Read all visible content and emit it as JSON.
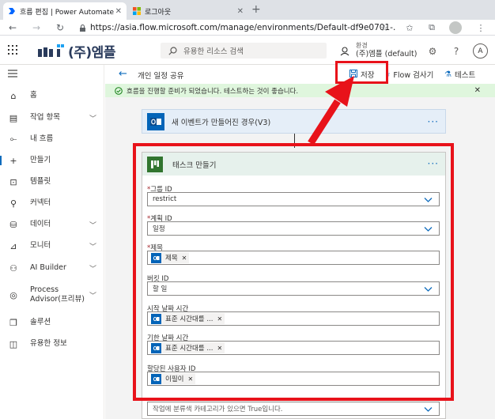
{
  "browser": {
    "tabs": [
      {
        "title": "흐름 편집 | Power Automate",
        "active": true
      },
      {
        "title": "로그아웃",
        "active": false
      }
    ],
    "url": "https://asia.flow.microsoft.com/manage/environments/Default-df9e0701-..."
  },
  "header": {
    "brand": "(주)엠플",
    "search_placeholder": "유용한 리소스 검색",
    "env_label": "환경",
    "env_value": "(주)엠플 (default)",
    "avatar_initial": "A"
  },
  "sidebar": {
    "items": [
      {
        "label": "홈",
        "icon": "home-icon",
        "has_chevron": false
      },
      {
        "label": "작업 항목",
        "icon": "clipboard-icon",
        "has_chevron": true
      },
      {
        "label": "내 흐름",
        "icon": "flow-icon",
        "has_chevron": false
      },
      {
        "label": "만들기",
        "icon": "plus-icon",
        "has_chevron": false,
        "active": true
      },
      {
        "label": "템플릿",
        "icon": "template-icon",
        "has_chevron": false
      },
      {
        "label": "커넥터",
        "icon": "connector-icon",
        "has_chevron": false
      },
      {
        "label": "데이터",
        "icon": "database-icon",
        "has_chevron": true
      },
      {
        "label": "모니터",
        "icon": "monitor-icon",
        "has_chevron": true
      },
      {
        "label": "AI Builder",
        "icon": "ai-builder-icon",
        "has_chevron": true
      },
      {
        "label": "Process Advisor(프리뷰)",
        "icon": "process-advisor-icon",
        "has_chevron": true
      },
      {
        "label": "솔루션",
        "icon": "solution-icon",
        "has_chevron": false
      },
      {
        "label": "유용한 정보",
        "icon": "book-icon",
        "has_chevron": false
      }
    ]
  },
  "command_bar": {
    "flow_name": "개인 일정 공유",
    "save_label": "저장",
    "checker_label": "Flow 검사기",
    "test_label": "테스트"
  },
  "banner": {
    "message": "흐름을 진행할 준비가 되었습니다. 테스트하는 것이 좋습니다."
  },
  "trigger": {
    "title": "새 이벤트가 만들어진 경우(V3)"
  },
  "action": {
    "title": "태스크 만들기",
    "fields": {
      "group": {
        "label": "그룹 ID",
        "required": true,
        "value": "restrict"
      },
      "plan": {
        "label": "계획 ID",
        "required": true,
        "value": "일정"
      },
      "title": {
        "label": "제목",
        "required": true,
        "token": "제목"
      },
      "bucket": {
        "label": "버킷 ID",
        "required": false,
        "value": "할 일"
      },
      "start": {
        "label": "시작 날짜 시간",
        "required": false,
        "token": "표준 시간대를 ..."
      },
      "due": {
        "label": "기한 날짜 시간",
        "required": false,
        "token": "표준 시간대를 ..."
      },
      "assignee": {
        "label": "할당된 사용자 ID",
        "required": false,
        "token": "이필이"
      }
    },
    "category_placeholder": "작업에 분류색 카테고리가 있으면 True입니다."
  },
  "colors": {
    "highlight": "#e8121a",
    "accent": "#0f6cbd",
    "outlook": "#0364b8",
    "planner": "#31752f",
    "banner_bg": "#dff6dd"
  }
}
